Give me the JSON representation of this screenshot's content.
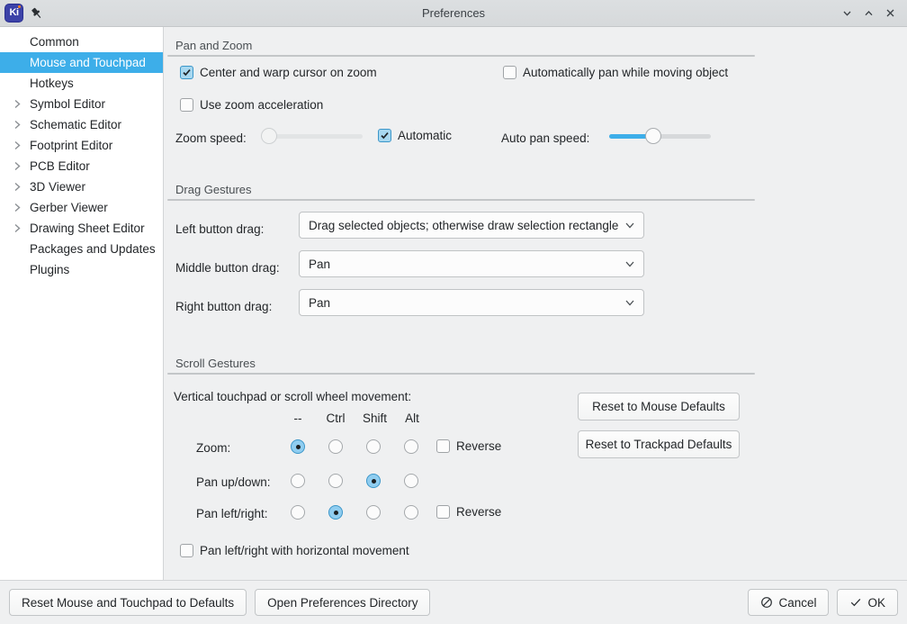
{
  "window": {
    "title": "Preferences",
    "logo_text": "Ki",
    "pin_icon": "pin-icon",
    "controls": [
      {
        "name": "minimize",
        "icon": "chevron-down-icon"
      },
      {
        "name": "maximize",
        "icon": "chevron-up-icon"
      },
      {
        "name": "close",
        "icon": "close-icon"
      }
    ]
  },
  "sidebar": {
    "items": [
      {
        "label": "Common",
        "expandable": false,
        "selected": false
      },
      {
        "label": "Mouse and Touchpad",
        "expandable": false,
        "selected": true
      },
      {
        "label": "Hotkeys",
        "expandable": false,
        "selected": false
      },
      {
        "label": "Symbol Editor",
        "expandable": true,
        "selected": false
      },
      {
        "label": "Schematic Editor",
        "expandable": true,
        "selected": false
      },
      {
        "label": "Footprint Editor",
        "expandable": true,
        "selected": false
      },
      {
        "label": "PCB Editor",
        "expandable": true,
        "selected": false
      },
      {
        "label": "3D Viewer",
        "expandable": true,
        "selected": false
      },
      {
        "label": "Gerber Viewer",
        "expandable": true,
        "selected": false
      },
      {
        "label": "Drawing Sheet Editor",
        "expandable": true,
        "selected": false
      },
      {
        "label": "Packages and Updates",
        "expandable": false,
        "selected": false
      },
      {
        "label": "Plugins",
        "expandable": false,
        "selected": false
      }
    ]
  },
  "pan_and_zoom": {
    "section_title": "Pan and Zoom",
    "center_warp": {
      "label": "Center and warp cursor on zoom",
      "checked": true
    },
    "auto_pan_object": {
      "label": "Automatically pan while moving object",
      "checked": false
    },
    "zoom_acceleration": {
      "label": "Use zoom acceleration",
      "checked": false
    },
    "zoom_speed_label": "Zoom speed:",
    "zoom_speed_value": 0,
    "zoom_speed_enabled": false,
    "automatic": {
      "label": "Automatic",
      "checked": true
    },
    "auto_pan_speed_label": "Auto pan speed:",
    "auto_pan_speed_value": 40
  },
  "drag_gestures": {
    "section_title": "Drag Gestures",
    "rows": [
      {
        "label": "Left button drag:",
        "value": "Drag selected objects; otherwise draw selection rectangle"
      },
      {
        "label": "Middle button drag:",
        "value": "Pan"
      },
      {
        "label": "Right button drag:",
        "value": "Pan"
      }
    ]
  },
  "scroll_gestures": {
    "section_title": "Scroll Gestures",
    "intro": "Vertical touchpad or scroll wheel movement:",
    "columns": [
      "--",
      "Ctrl",
      "Shift",
      "Alt"
    ],
    "rows": [
      {
        "label": "Zoom:",
        "selected_index": 0,
        "reverse": {
          "label": "Reverse",
          "checked": false,
          "show": true
        }
      },
      {
        "label": "Pan up/down:",
        "selected_index": 2,
        "reverse": {
          "label": "",
          "checked": false,
          "show": false
        }
      },
      {
        "label": "Pan left/right:",
        "selected_index": 1,
        "reverse": {
          "label": "Reverse",
          "checked": false,
          "show": true
        }
      }
    ],
    "horizontal_pan": {
      "label": "Pan left/right with horizontal movement",
      "checked": false
    },
    "reset_mouse": "Reset to Mouse Defaults",
    "reset_trackpad": "Reset to Trackpad Defaults"
  },
  "footer": {
    "reset_defaults": "Reset Mouse and Touchpad to Defaults",
    "open_prefs_dir": "Open Preferences Directory",
    "cancel": "Cancel",
    "ok": "OK"
  },
  "colors": {
    "accent": "#3daee9",
    "window_bg": "#eff0f1",
    "sidebar_bg": "#ffffff",
    "text": "#232629"
  }
}
